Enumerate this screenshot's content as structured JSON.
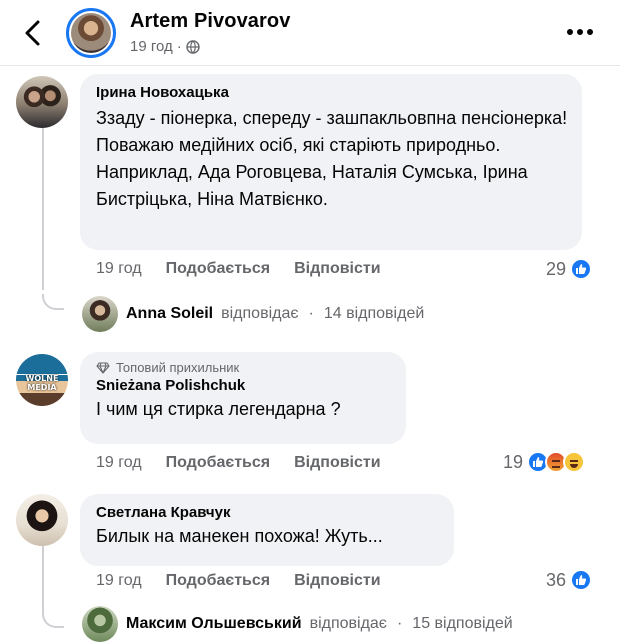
{
  "header": {
    "name": "Artem Pivovarov",
    "time": "19 год",
    "dot": "·"
  },
  "comments": [
    {
      "author": "Ірина Новохацька",
      "text": "Ззаду - піонерка, спереду - зашпакльовпна пенсіонерка! Поважаю медійних осіб, які старіють природньо. Наприклад, Ада Роговцева, Наталія Сумська, Ірина Бистріцька, Ніна Матвієнко.",
      "time": "19 год",
      "like_label": "Подобається",
      "reply_label": "Відповісти",
      "reaction_count": "29",
      "reactions": [
        "like-icon"
      ],
      "reply_summary": {
        "name": "Anna Soleil",
        "verb": "відповідає",
        "dot": "·",
        "count": "14 відповідей"
      }
    },
    {
      "badge": "Топовий прихильник",
      "author": "Snieżana Polishchuk",
      "avatar_text": "WOLNE MEDIA",
      "text": "І чим ця стирка легендарна ?",
      "time": "19 год",
      "like_label": "Подобається",
      "reply_label": "Відповісти",
      "reaction_count": "19",
      "reactions": [
        "like-icon",
        "angry-icon",
        "haha-icon"
      ]
    },
    {
      "author": "Светлана Кравчук",
      "text": "Билык на манекен похожа! Жуть...",
      "time": "19 год",
      "like_label": "Подобається",
      "reply_label": "Відповісти",
      "reaction_count": "36",
      "reactions": [
        "like-icon"
      ],
      "reply_summary": {
        "name": "Максим Ольшевський",
        "verb": "відповідає",
        "dot": "·",
        "count": "15 відповідей"
      }
    }
  ],
  "colors": {
    "accent": "#1877f2",
    "bubble": "#f0f2f5",
    "meta": "#65676b"
  }
}
